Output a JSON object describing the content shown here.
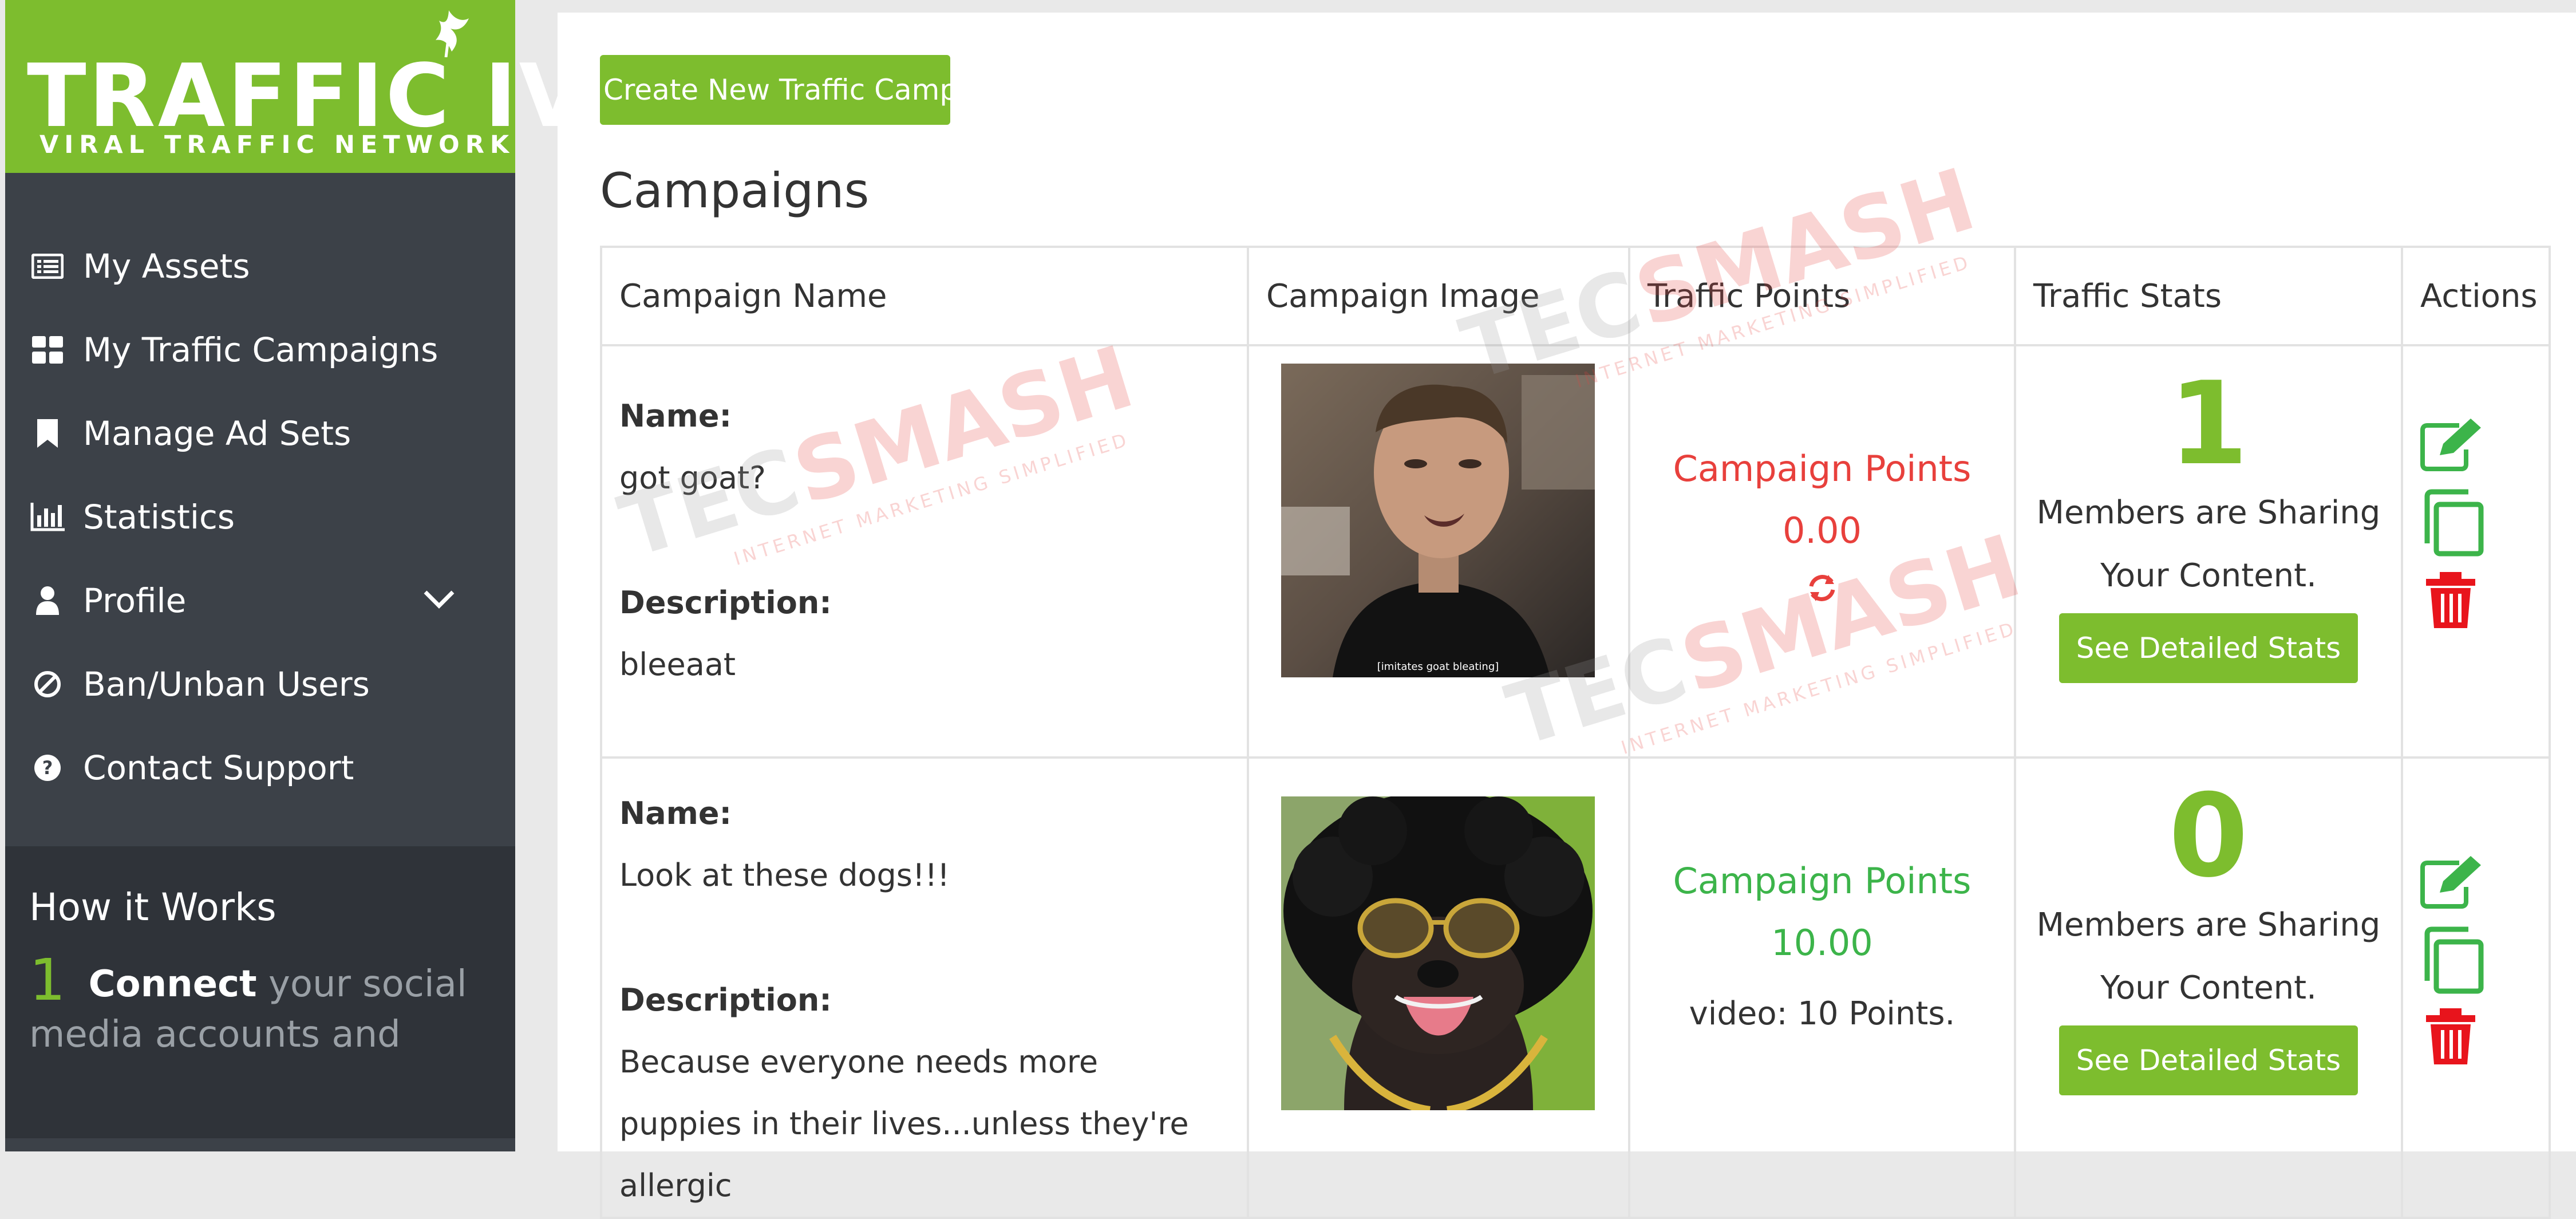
{
  "brand": {
    "name": "TRAFFIC IVY",
    "tagline": "VIRAL TRAFFIC NETWORK",
    "accent_color": "#7dbd2e"
  },
  "sidebar": {
    "items": [
      {
        "label": "My Assets",
        "icon": "list-icon"
      },
      {
        "label": "My Traffic Campaigns",
        "icon": "dashboard-icon"
      },
      {
        "label": "Manage Ad Sets",
        "icon": "bookmark-icon"
      },
      {
        "label": "Statistics",
        "icon": "bar-chart-icon"
      },
      {
        "label": "Profile",
        "icon": "user-icon"
      },
      {
        "label": "Ban/Unban Users",
        "icon": "ban-icon"
      },
      {
        "label": "Contact Support",
        "icon": "question-circle-icon"
      }
    ],
    "how_it_works": {
      "title": "How it Works",
      "step_number": "1",
      "step_strong": "Connect",
      "step_text": "your social media accounts and"
    }
  },
  "main": {
    "create_button": "Create New Traffic Campaign",
    "title": "Campaigns",
    "columns": [
      "Campaign Name",
      "Campaign Image",
      "Traffic Points",
      "Traffic Stats",
      "Actions"
    ],
    "name_label": "Name:",
    "description_label": "Description:",
    "points_label": "Campaign Points",
    "stats_text_1": "Members are Sharing",
    "stats_text_2": "Your Content.",
    "stats_button": "See Detailed Stats",
    "rows": [
      {
        "name": "got goat?",
        "description": "bleeaat",
        "image": "man-photo",
        "image_caption": "[imitates goat bleating]",
        "points": "0.00",
        "points_color": "#e8403c",
        "sharing_count": "1"
      },
      {
        "name": "Look at these dogs!!!",
        "description": "Because everyone needs more puppies in their lives...unless they're allergic",
        "image": "dog-photo",
        "points": "10.00",
        "points_color": "#3cb44a",
        "points_detail": "video: 10 Points.",
        "sharing_count": "0"
      }
    ]
  },
  "watermark": {
    "text_a": "TEC",
    "text_b": "SMASH",
    "sub": "INTERNET MARKETING SIMPLIFIED"
  }
}
